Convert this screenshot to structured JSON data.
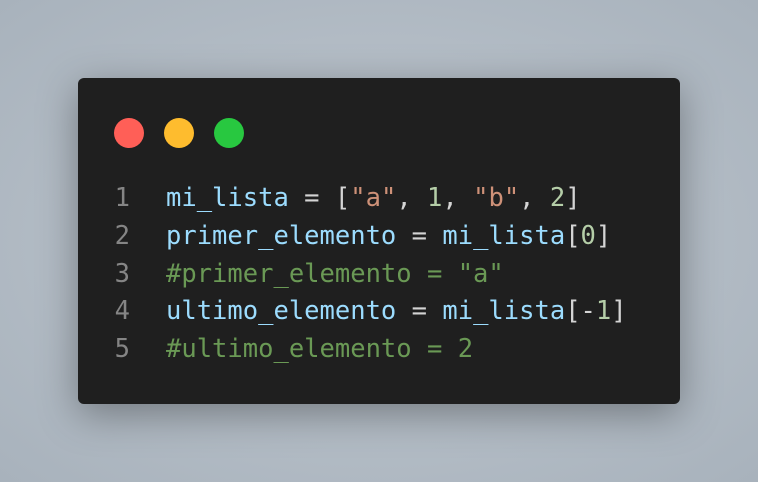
{
  "window": {
    "buttons": [
      {
        "name": "close",
        "color": "#ff5f57"
      },
      {
        "name": "minimize",
        "color": "#febc2e"
      },
      {
        "name": "maximize",
        "color": "#28c840"
      }
    ]
  },
  "code": {
    "lines": [
      {
        "number": "1",
        "tokens": [
          {
            "t": "mi_lista",
            "k": "v"
          },
          {
            "t": " = [",
            "k": "o"
          },
          {
            "t": "\"a\"",
            "k": "s"
          },
          {
            "t": ", ",
            "k": "o"
          },
          {
            "t": "1",
            "k": "n"
          },
          {
            "t": ", ",
            "k": "o"
          },
          {
            "t": "\"b\"",
            "k": "s"
          },
          {
            "t": ", ",
            "k": "o"
          },
          {
            "t": "2",
            "k": "n"
          },
          {
            "t": "]",
            "k": "o"
          }
        ]
      },
      {
        "number": "2",
        "tokens": [
          {
            "t": "primer_elemento",
            "k": "v"
          },
          {
            "t": " = ",
            "k": "o"
          },
          {
            "t": "mi_lista",
            "k": "v"
          },
          {
            "t": "[",
            "k": "o"
          },
          {
            "t": "0",
            "k": "n"
          },
          {
            "t": "]",
            "k": "o"
          }
        ]
      },
      {
        "number": "3",
        "tokens": [
          {
            "t": "#primer_elemento = \"a\"",
            "k": "c"
          }
        ]
      },
      {
        "number": "4",
        "tokens": [
          {
            "t": "ultimo_elemento",
            "k": "v"
          },
          {
            "t": " = ",
            "k": "o"
          },
          {
            "t": "mi_lista",
            "k": "v"
          },
          {
            "t": "[-",
            "k": "o"
          },
          {
            "t": "1",
            "k": "n"
          },
          {
            "t": "]",
            "k": "o"
          }
        ]
      },
      {
        "number": "5",
        "tokens": [
          {
            "t": "#ultimo_elemento = 2",
            "k": "c"
          }
        ]
      }
    ]
  }
}
